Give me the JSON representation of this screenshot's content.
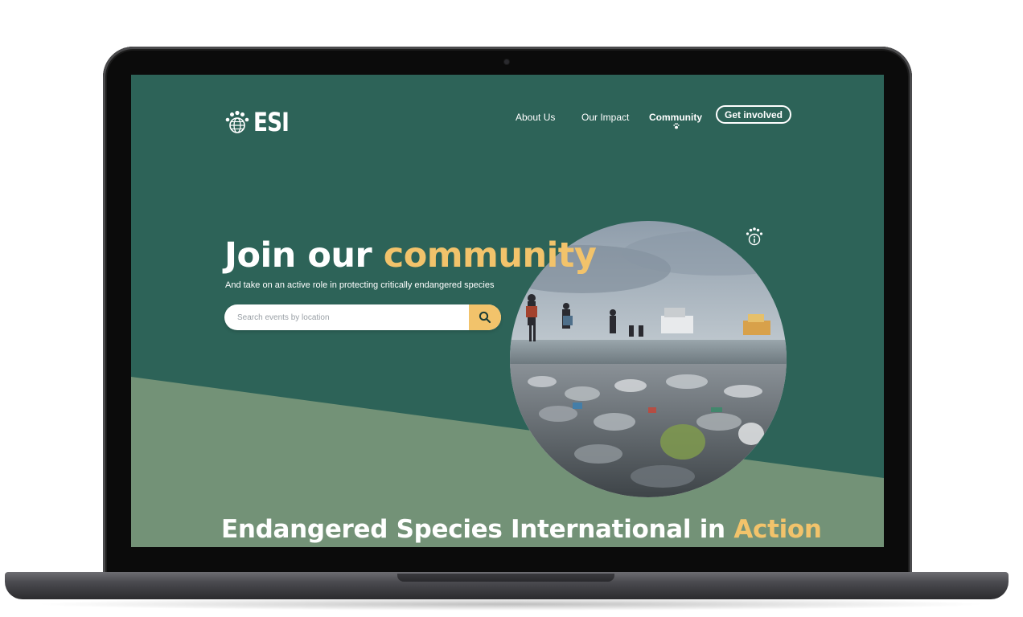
{
  "brand": {
    "name": "ESI",
    "logo_icon": "paw-globe-icon"
  },
  "nav": {
    "items": [
      {
        "label": "About Us",
        "active": false
      },
      {
        "label": "Our Impact",
        "active": false
      },
      {
        "label": "Community",
        "active": true
      }
    ],
    "cta_label": "Get involved"
  },
  "hero": {
    "title_main": "Join our ",
    "title_accent": "community",
    "subtitle": "And take on an active role in protecting critically endangered species",
    "search": {
      "placeholder": "Search events by location",
      "value": "",
      "button_icon": "search-icon"
    },
    "info_icon": "paw-info-icon"
  },
  "section": {
    "title_main": "Endangered Species International in ",
    "title_accent": "Action"
  },
  "colors": {
    "primary_green": "#2d6358",
    "light_green": "#739277",
    "accent_yellow": "#f2c36b",
    "white": "#ffffff"
  }
}
